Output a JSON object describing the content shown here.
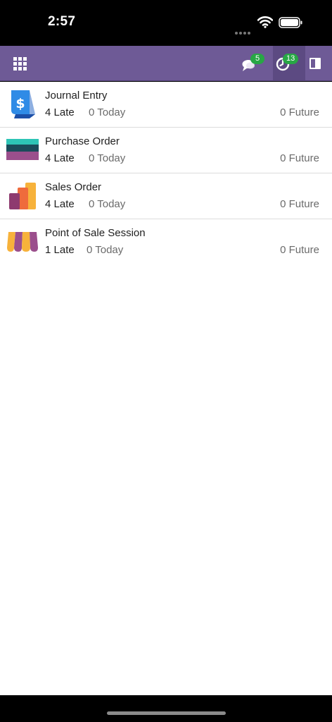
{
  "status_bar": {
    "time": "2:57"
  },
  "navbar": {
    "messages_count": "5",
    "activities_count": "13"
  },
  "activities": [
    {
      "title": "Journal Entry",
      "late": "4 Late",
      "today": "0 Today",
      "future": "0 Future",
      "icon": "journal-entry-icon"
    },
    {
      "title": "Purchase Order",
      "late": "4 Late",
      "today": "0 Today",
      "future": "0 Future",
      "icon": "purchase-order-icon"
    },
    {
      "title": "Sales Order",
      "late": "4 Late",
      "today": "0 Today",
      "future": "0 Future",
      "icon": "sales-order-icon"
    },
    {
      "title": "Point of Sale Session",
      "late": "1 Late",
      "today": "0 Today",
      "future": "0 Future",
      "icon": "point-of-sale-icon"
    }
  ],
  "colors": {
    "navbar": "#6e5a96",
    "badge": "#28a745"
  }
}
